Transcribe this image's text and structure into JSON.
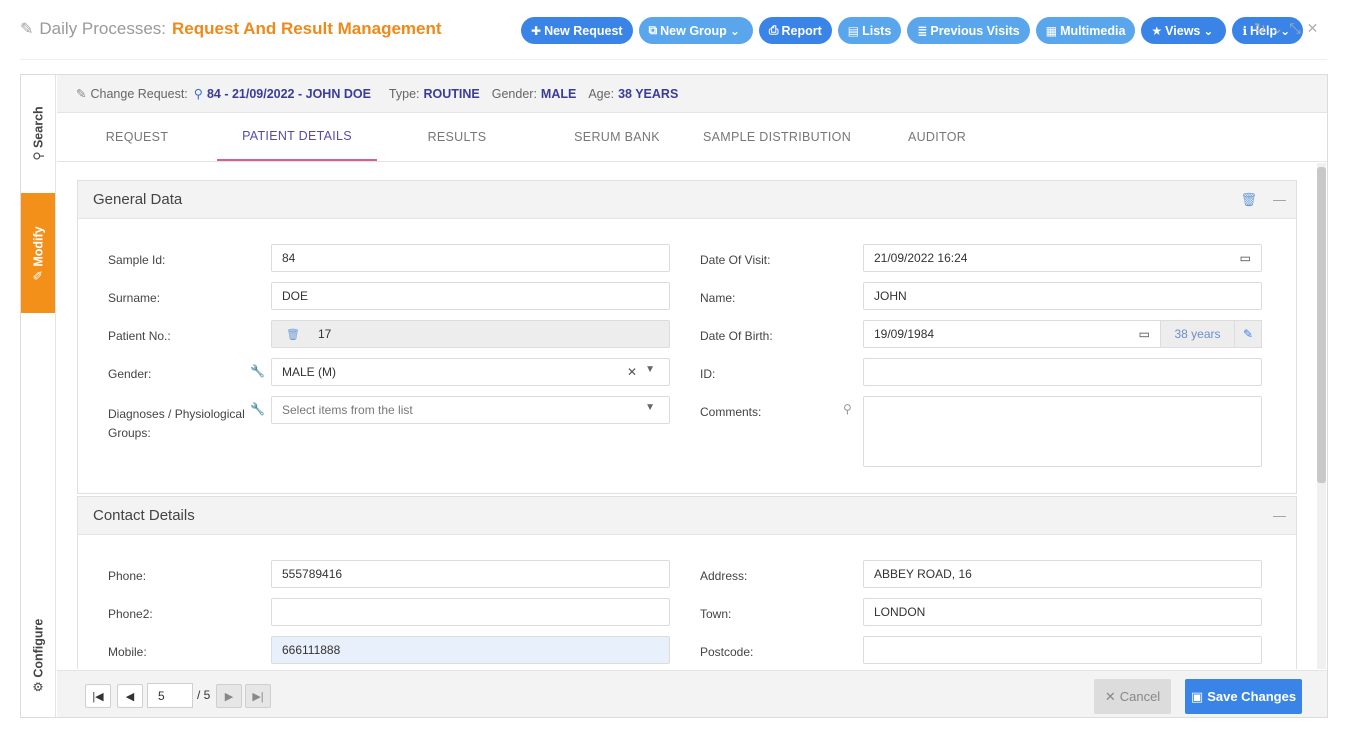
{
  "header": {
    "title_prefix": "Daily Processes:",
    "title_main": "Request And Result Management",
    "buttons": [
      {
        "label": "New Request",
        "icon": "+"
      },
      {
        "label": "New Group",
        "icon": "⧉"
      },
      {
        "label": "Report",
        "icon": "⎙"
      },
      {
        "label": "Lists",
        "icon": "▤"
      },
      {
        "label": "Previous Visits",
        "icon": "≣"
      },
      {
        "label": "Multimedia",
        "icon": "▦"
      },
      {
        "label": "Views",
        "icon": "★"
      },
      {
        "label": "Help",
        "icon": "ℹ"
      }
    ]
  },
  "sidebar": {
    "search": "Search",
    "modify": "Modify",
    "configure": "Configure"
  },
  "request": {
    "label": "Change Request:",
    "id": "84 - 21/09/2022 - JOHN DOE",
    "type_label": "Type:",
    "type_value": "ROUTINE",
    "gender_label": "Gender:",
    "gender_value": "MALE",
    "age_label": "Age:",
    "age_value": "38 YEARS"
  },
  "tabs": [
    "REQUEST",
    "PATIENT DETAILS",
    "RESULTS",
    "SERUM BANK",
    "SAMPLE DISTRIBUTION",
    "AUDITOR"
  ],
  "general": {
    "title": "General Data",
    "sample_id_label": "Sample Id:",
    "sample_id": "84",
    "surname_label": "Surname:",
    "surname": "DOE",
    "patient_no_label": "Patient No.:",
    "patient_no": "17",
    "gender_label": "Gender:",
    "gender": "MALE (M)",
    "diagnoses_label_1": "Diagnoses / Physiological",
    "diagnoses_label_2": "Groups:",
    "diagnoses_placeholder": "Select items from the list",
    "date_visit_label": "Date Of Visit:",
    "date_visit": "21/09/2022 16:24",
    "name_label": "Name:",
    "name": "JOHN",
    "dob_label": "Date Of Birth:",
    "dob": "19/09/1984",
    "age_addon": "38 years",
    "id_label": "ID:",
    "id": "",
    "comments_label": "Comments:"
  },
  "contact": {
    "title": "Contact Details",
    "phone_label": "Phone:",
    "phone": "555789416",
    "phone2_label": "Phone2:",
    "phone2": "",
    "mobile_label": "Mobile:",
    "mobile": "666111888",
    "address_label": "Address:",
    "address": "ABBEY ROAD, 16",
    "town_label": "Town:",
    "town": "LONDON",
    "postcode_label": "Postcode:",
    "postcode": ""
  },
  "pager": {
    "current": "5",
    "total": "/ 5"
  },
  "footer": {
    "cancel": "Cancel",
    "save": "Save Changes"
  },
  "colors": {
    "accent": "#3a84e8",
    "brand_orange": "#f39019",
    "title_orange": "#ee8a1a",
    "tab_underline": "#e05a8a"
  }
}
